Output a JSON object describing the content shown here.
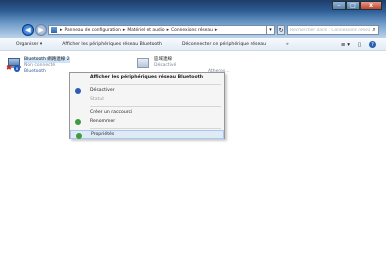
{
  "window": {
    "controls": {
      "minimize": "–",
      "maximize": "□",
      "close": "x"
    }
  },
  "navigation": {
    "back_glyph": "◀",
    "forward_glyph": "▶",
    "address_segments": [
      "Panneau de configuration",
      "Matériel et audio",
      "Connexions réseau"
    ],
    "address_separator": "▸",
    "dropdown_glyph": "▾",
    "refresh_glyph": "↻",
    "search_placeholder": "Rechercher dans : Connexions réseau",
    "search_glyph": "⌕"
  },
  "commandbar": {
    "items": [
      "Organiser ▾",
      "Afficher les périphériques réseau Bluetooth",
      "Déconnecter ce périphérique réseau",
      "»"
    ],
    "right": {
      "views": "≡ ▾",
      "pane": "▯",
      "help": "?"
    }
  },
  "devices": [
    {
      "name": "Bluetooth 網路連線 2",
      "status": "Non connecté",
      "adapter": "Bluetooth",
      "icon": "bluetooth-network-icon"
    },
    {
      "name": "區域連線",
      "status": "Désactivé",
      "adapter": "Atheros...",
      "icon": "network-adapter-icon"
    }
  ],
  "context_menu": {
    "items": [
      {
        "label": "Afficher les périphériques réseau Bluetooth",
        "style": "bold",
        "icon": ""
      },
      {
        "label": "Désactiver",
        "style": "normal",
        "icon": "shield"
      },
      {
        "label": "Statut",
        "style": "disabled",
        "icon": ""
      },
      {
        "label": "Créer un raccourci",
        "style": "normal",
        "icon": "",
        "separator_before": true
      },
      {
        "label": "Renommer",
        "style": "normal",
        "icon": "shield"
      },
      {
        "label": "Propriétés",
        "style": "highlight",
        "icon": "shield",
        "separator_before": true
      }
    ]
  },
  "colors": {
    "accent": "#2a5fb0",
    "disabled_text": "#9aa0a6",
    "error_x": "#d12222"
  }
}
